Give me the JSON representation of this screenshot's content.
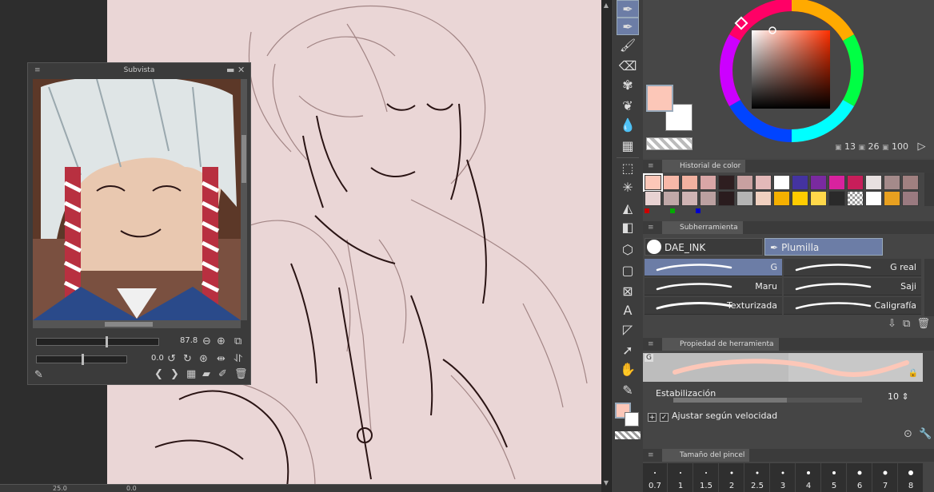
{
  "subvista": {
    "title": "Subvista",
    "zoom": "87.8",
    "rotation": "0.0"
  },
  "colors": {
    "main": "#fcc7b8",
    "sub": "#ffffff",
    "h": "13",
    "s": "26",
    "v": "100"
  },
  "history": {
    "title": "Historial de color",
    "row1": [
      "#fcc7b8",
      "#f7b8a8",
      "#f2b1a0",
      "#d9a6a6",
      "#2e1e20",
      "#c8a0a0",
      "#e3b9b9",
      "#ffffff",
      "#4433a0",
      "#7a2aa0",
      "#d8229e",
      "#c81e5a",
      "#e8e0e0",
      "#a48a8a",
      "#a08080"
    ],
    "row2": [
      "#e8d2d2",
      "#c0a8a8",
      "#cfb3b3",
      "#bba0a0",
      "#2a1c1e",
      "#b4b4b4",
      "#f0d0c0",
      "#f5b000",
      "#ffcc00",
      "#ffd84a",
      "#2a2a2a",
      "checker",
      "#ffffff",
      "#e8a020",
      "#9a7a80"
    ]
  },
  "subtool": {
    "title": "Subherramienta",
    "group1": "DAE_INK",
    "group2": "Plumilla",
    "brushes": [
      {
        "label": "G"
      },
      {
        "label": "G real"
      },
      {
        "label": "Maru"
      },
      {
        "label": "Saji"
      },
      {
        "label": "Texturizada"
      },
      {
        "label": "Caligrafía"
      }
    ]
  },
  "property": {
    "title": "Propiedad de herramienta",
    "tag": "G",
    "stab_label": "Estabilización",
    "stab_value": "10",
    "speed_label": "Ajustar según velocidad"
  },
  "brush_size": {
    "title": "Tamaño del pincel",
    "sizes": [
      {
        "v": "0.7",
        "d": 2
      },
      {
        "v": "1",
        "d": 2
      },
      {
        "v": "1.5",
        "d": 2
      },
      {
        "v": "2",
        "d": 3
      },
      {
        "v": "2.5",
        "d": 3
      },
      {
        "v": "3",
        "d": 3
      },
      {
        "v": "4",
        "d": 4
      },
      {
        "v": "5",
        "d": 4
      },
      {
        "v": "6",
        "d": 5
      },
      {
        "v": "7",
        "d": 5
      },
      {
        "v": "8",
        "d": 6
      }
    ]
  },
  "bottom": {
    "zoom": "25.0",
    "rot": "0.0"
  }
}
